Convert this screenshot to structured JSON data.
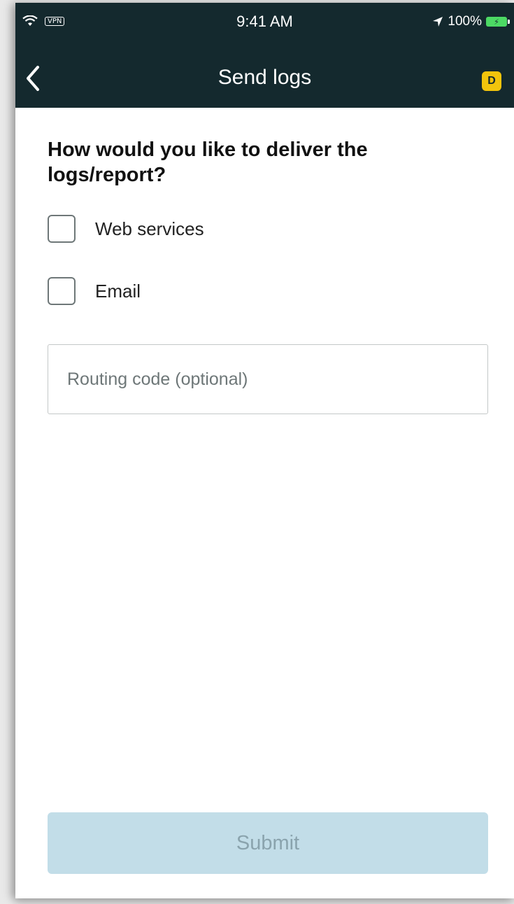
{
  "status_bar": {
    "vpn_label": "VPN",
    "time": "9:41 AM",
    "battery_percent": "100%",
    "wifi_icon": "wifi-icon",
    "location_icon": "location-arrow-icon",
    "battery_icon": "battery-charging-icon"
  },
  "nav": {
    "title": "Send logs",
    "back_icon": "chevron-left-icon",
    "badge_label": "D",
    "background_color": "#14292e",
    "badge_color": "#f2c40c"
  },
  "form": {
    "question": "How would you like to deliver the logs/report?",
    "options": [
      {
        "label": "Web services",
        "checked": false
      },
      {
        "label": "Email",
        "checked": false
      }
    ],
    "routing_placeholder": "Routing code (optional)",
    "submit_label": "Submit",
    "submit_color": "#c2dde8"
  }
}
